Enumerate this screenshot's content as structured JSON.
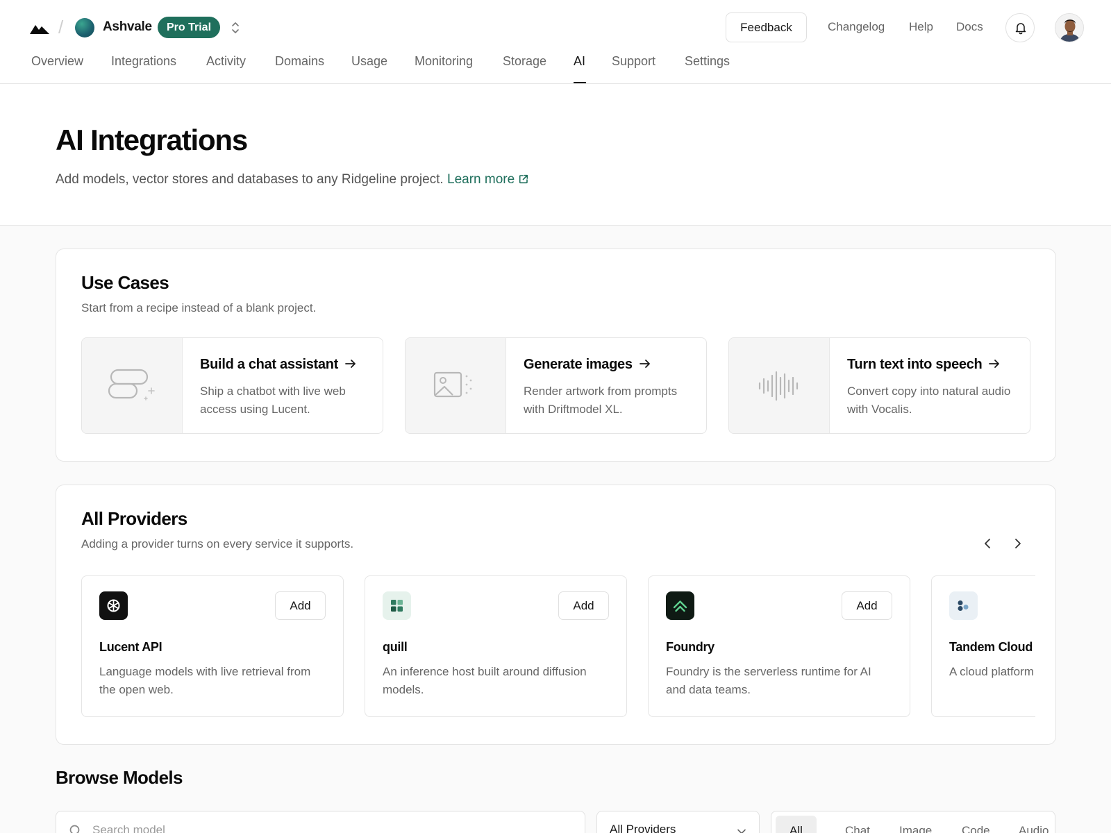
{
  "topbar": {
    "team_name": "Ashvale",
    "plan_badge": "Pro Trial",
    "feedback_label": "Feedback",
    "links": [
      "Changelog",
      "Help",
      "Docs"
    ]
  },
  "nav": {
    "tabs": [
      "Overview",
      "Integrations",
      "Activity",
      "Domains",
      "Usage",
      "Monitoring",
      "Storage",
      "AI",
      "Support",
      "Settings"
    ],
    "active_tab": "AI"
  },
  "hero": {
    "title": "AI Integrations",
    "subtitle": "Add models, vector stores and databases to any Ridgeline project.",
    "learn_more": "Learn more"
  },
  "use_cases": {
    "title": "Use Cases",
    "subtitle": "Start from a recipe instead of a blank project.",
    "items": [
      {
        "title": "Build a chat assistant",
        "description": "Ship a chatbot with live web access using Lucent.",
        "icon": "chat-bubbles-icon"
      },
      {
        "title": "Generate images",
        "description": "Render artwork from prompts with Driftmodel XL.",
        "icon": "image-icon"
      },
      {
        "title": "Turn text into speech",
        "description": "Convert copy into natural audio with Vocalis.",
        "icon": "waveform-icon"
      }
    ]
  },
  "providers": {
    "title": "All Providers",
    "subtitle": "Adding a provider turns on every service it supports.",
    "add_label": "Add",
    "items": [
      {
        "name": "Lucent API",
        "description": "Language models with live retrieval from the open web.",
        "icon": "lucent-icon"
      },
      {
        "name": "quill",
        "description": "An inference host built around diffusion models.",
        "icon": "quill-icon"
      },
      {
        "name": "Foundry",
        "description": "Foundry is the serverless runtime for AI and data teams.",
        "icon": "foundry-icon"
      },
      {
        "name": "Tandem Cloud",
        "description": "A cloud platform for tuning open models.",
        "icon": "tandem-icon"
      }
    ]
  },
  "browse": {
    "title": "Browse Models",
    "search_placeholder": "Search model",
    "provider_select": "All Providers",
    "filters": [
      "All",
      "Chat",
      "Image",
      "Code",
      "Audio"
    ],
    "active_filter": "All"
  },
  "colors": {
    "accent": "#1f6f5c",
    "text": "#171717",
    "muted": "#666666",
    "border": "#e5e5e5"
  }
}
